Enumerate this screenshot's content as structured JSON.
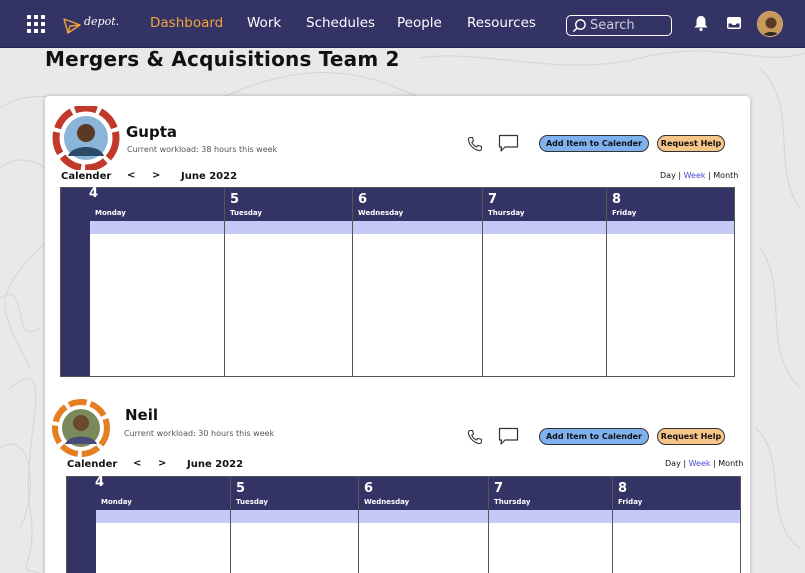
{
  "nav": {
    "logo_text": "depot.",
    "links": [
      {
        "label": "Dashboard",
        "active": true
      },
      {
        "label": "Work",
        "active": false
      },
      {
        "label": "Schedules",
        "active": false
      },
      {
        "label": "People",
        "active": false
      },
      {
        "label": "Resources",
        "active": false
      }
    ],
    "search_placeholder": "Search"
  },
  "colors": {
    "nav_bg": "#333366",
    "active_link": "#f2a33a",
    "add_button": "#7fb1ef",
    "help_button": "#f6c58a",
    "calendar_band": "#c6c9f6",
    "ring_red": "#c0392b",
    "ring_orange": "#e67e22"
  },
  "page_title": "Mergers & Acquisitions Team 2",
  "members": [
    {
      "name": "Gupta",
      "workload": "Current workload: 38 hours this week",
      "ring_color": "red",
      "add_label": "Add Item to Calender",
      "help_label": "Request Help",
      "cal_label": "Calender",
      "prev": "<",
      "next": ">",
      "month": "June 2022",
      "views": {
        "day": "Day",
        "week": "Week",
        "month": "Month",
        "selected": "Week"
      },
      "first_day_num": "4",
      "days": [
        {
          "num": "5",
          "name": "Tuesday"
        },
        {
          "num": "6",
          "name": "Wednesday"
        },
        {
          "num": "7",
          "name": "Thursday"
        },
        {
          "num": "8",
          "name": "Friday"
        }
      ],
      "first_day_name": "Monday"
    },
    {
      "name": "Neil",
      "workload": "Current workload: 30 hours this week",
      "ring_color": "orange",
      "add_label": "Add Item to Calender",
      "help_label": "Request Help",
      "cal_label": "Calender",
      "prev": "<",
      "next": ">",
      "month": "June 2022",
      "views": {
        "day": "Day",
        "week": "Week",
        "month": "Month",
        "selected": "Week"
      },
      "first_day_num": "4",
      "days": [
        {
          "num": "5",
          "name": "Tuesday"
        },
        {
          "num": "6",
          "name": "Wednesday"
        },
        {
          "num": "7",
          "name": "Thursday"
        },
        {
          "num": "8",
          "name": "Friday"
        }
      ],
      "first_day_name": "Monday"
    }
  ]
}
